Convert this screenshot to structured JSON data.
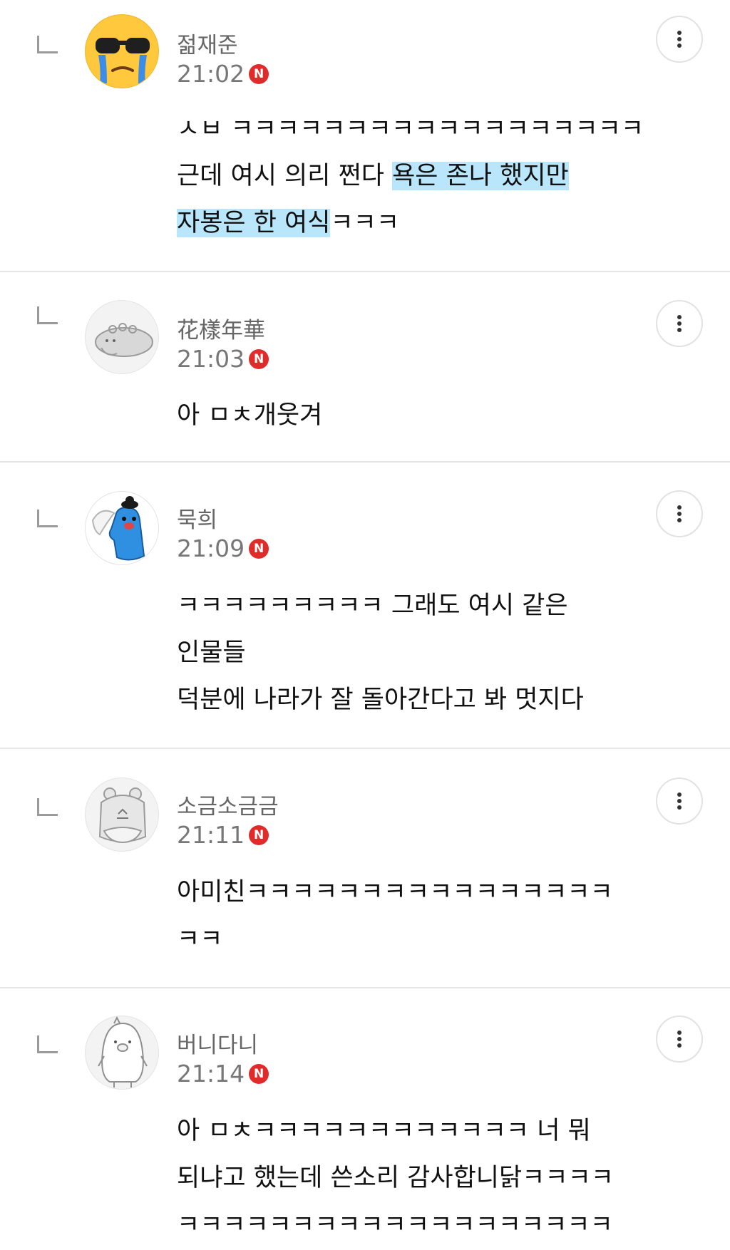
{
  "comments": [
    {
      "author": "젊재준",
      "time": "21:02",
      "badge": "N",
      "avatar": "sunglasses-crying-emoji",
      "lines": [
        {
          "segments": [
            {
              "text": "ㅅㅂ ㅋㅋㅋㅋㅋㅋㅋㅋㅋㅋㅋㅋㅋㅋㅋㅋㅋㅋ",
              "hl": false
            }
          ]
        },
        {
          "segments": [
            {
              "text": "근데 여시 의리 쩐다 ",
              "hl": false
            },
            {
              "text": "욕은 존나 했지만",
              "hl": true
            }
          ]
        },
        {
          "segments": [
            {
              "text": "자봉은 한 여식",
              "hl": true
            },
            {
              "text": "ㅋㅋㅋ",
              "hl": false
            }
          ]
        }
      ]
    },
    {
      "author": "花樣年華",
      "time": "21:03",
      "badge": "N",
      "avatar": "grey-creature-avatar",
      "lines": [
        {
          "segments": [
            {
              "text": "아 ㅁㅊ개웃겨",
              "hl": false
            }
          ]
        }
      ]
    },
    {
      "author": "묵희",
      "time": "21:09",
      "badge": "N",
      "avatar": "blue-character-avatar",
      "lines": [
        {
          "segments": [
            {
              "text": "ㅋㅋㅋㅋㅋㅋㅋㅋㅋ 그래도 여시 같은",
              "hl": false
            }
          ]
        },
        {
          "segments": [
            {
              "text": "인물들",
              "hl": false
            }
          ]
        },
        {
          "segments": [
            {
              "text": "덕분에 나라가 잘 돌아간다고 봐 멋지다",
              "hl": false
            }
          ]
        }
      ]
    },
    {
      "author": "소금소금금",
      "time": "21:11",
      "badge": "N",
      "avatar": "bear-avatar",
      "lines": [
        {
          "segments": [
            {
              "text": "아미친ㅋㅋㅋㅋㅋㅋㅋㅋㅋㅋㅋㅋㅋㅋㅋㅋ",
              "hl": false
            }
          ]
        },
        {
          "segments": [
            {
              "text": "ㅋㅋ",
              "hl": false
            }
          ]
        }
      ]
    },
    {
      "author": "버니다니",
      "time": "21:14",
      "badge": "N",
      "avatar": "penguin-avatar",
      "lines": [
        {
          "segments": [
            {
              "text": "아 ㅁㅊㅋㅋㅋㅋㅋㅋㅋㅋㅋㅋㅋㅋ 너 뭐",
              "hl": false
            }
          ]
        },
        {
          "segments": [
            {
              "text": "되냐고 했는데 쓴소리 감사합니닭ㅋㅋㅋㅋ",
              "hl": false
            }
          ]
        },
        {
          "segments": [
            {
              "text": "ㅋㅋㅋㅋㅋㅋㅋㅋㅋㅋㅋㅋㅋㅋㅋㅋㅋㅋㅋ",
              "hl": false
            }
          ]
        }
      ]
    }
  ],
  "colors": {
    "highlight": "#b9e6fb",
    "badge": "#e12b2b",
    "divider": "#e6e6e6"
  },
  "icons": {
    "more": "more-vertical-icon",
    "reply": "reply-indent-icon"
  }
}
